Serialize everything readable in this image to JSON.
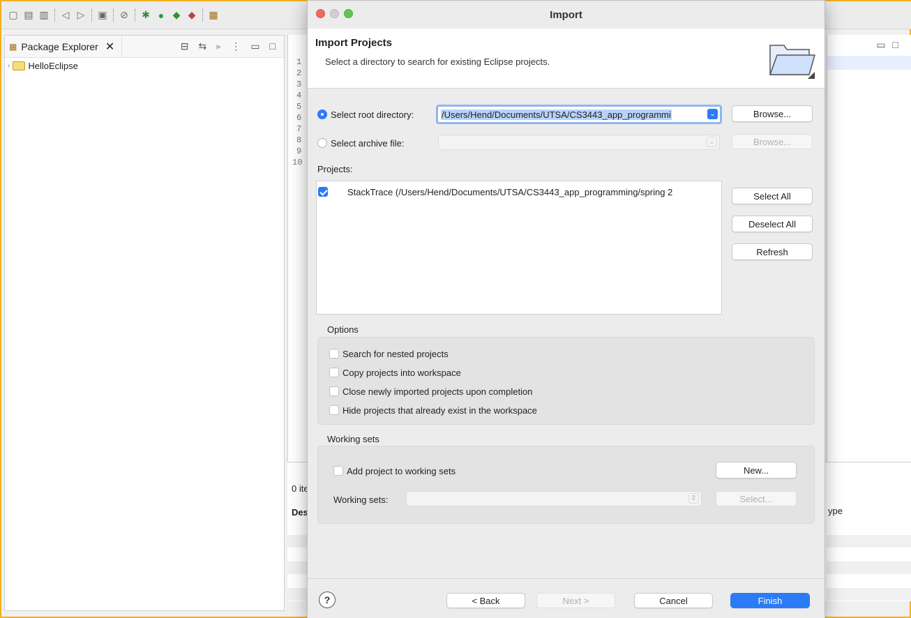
{
  "eclipse": {
    "package_explorer": {
      "tab_label": "Package Explorer",
      "close_glyph": "✕",
      "project": "HelloEclipse"
    },
    "line_numbers": [
      "1",
      "2",
      "3",
      "4",
      "5",
      "6",
      "7",
      "8",
      "9",
      "10"
    ],
    "bottom_panel": {
      "items_count": "0 ite",
      "col_description": "Des",
      "col_type": "ype"
    }
  },
  "dialog": {
    "window_title": "Import",
    "banner": {
      "title": "Import Projects",
      "description": "Select a directory to search for existing Eclipse projects."
    },
    "root_directory": {
      "label": "Select root directory:",
      "value": "/Users/Hend/Documents/UTSA/CS3443_app_programmi",
      "selected": true,
      "browse": "Browse..."
    },
    "archive_file": {
      "label": "Select archive file:",
      "value": "",
      "selected": false,
      "browse": "Browse..."
    },
    "projects": {
      "label": "Projects:",
      "items": [
        {
          "label": "StackTrace (/Users/Hend/Documents/UTSA/CS3443_app_programming/spring 2",
          "checked": true
        }
      ],
      "select_all": "Select All",
      "deselect_all": "Deselect All",
      "refresh": "Refresh"
    },
    "options": {
      "label": "Options",
      "items": [
        {
          "label": "Search for nested projects",
          "checked": false
        },
        {
          "label": "Copy projects into workspace",
          "checked": false
        },
        {
          "label": "Close newly imported projects upon completion",
          "checked": false
        },
        {
          "label": "Hide projects that already exist in the workspace",
          "checked": false
        }
      ]
    },
    "working_sets": {
      "label": "Working sets",
      "add_label": "Add project to working sets",
      "add_checked": false,
      "new_button": "New...",
      "sets_label": "Working sets:",
      "sets_value": "",
      "select_button": "Select..."
    },
    "footer": {
      "help": "?",
      "back": "< Back",
      "next": "Next >",
      "cancel": "Cancel",
      "finish": "Finish"
    }
  },
  "colors": {
    "accent": "#2b7bf6",
    "window_border": "#f2b01e"
  }
}
